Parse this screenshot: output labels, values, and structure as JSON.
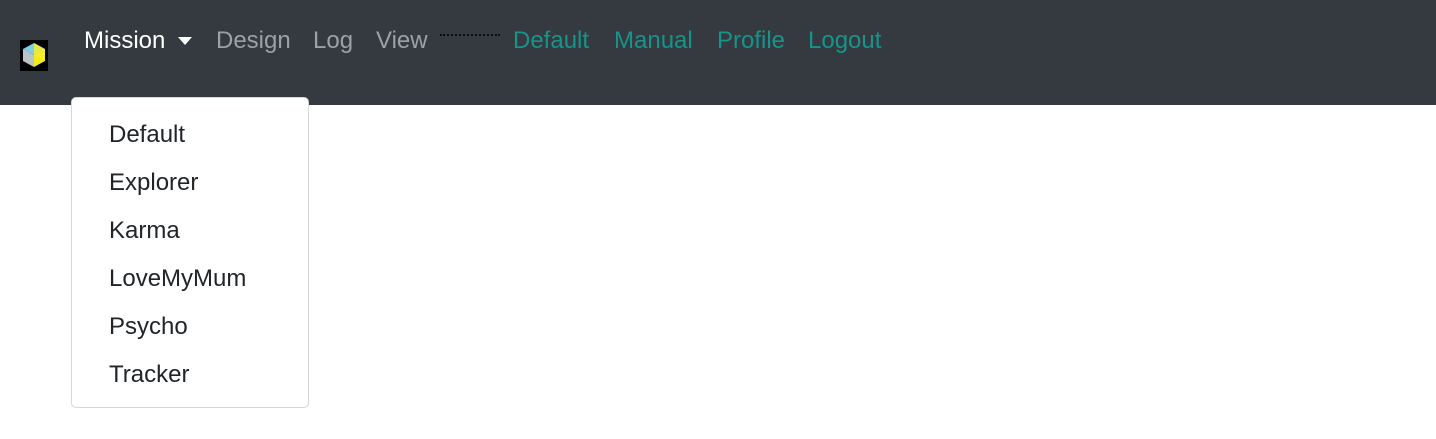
{
  "navbar": {
    "brand_icon": "cube-logo-icon",
    "mission_label": "Mission",
    "design_label": "Design",
    "log_label": "Log",
    "view_label": "View",
    "default_label": "Default",
    "manual_label": "Manual",
    "profile_label": "Profile",
    "logout_label": "Logout",
    "colors": {
      "background": "#343a40",
      "active": "#ffffff",
      "muted": "#9da1a6",
      "accent": "#17948a"
    }
  },
  "mission_menu": {
    "items": [
      "Default",
      "Explorer",
      "Karma",
      "LoveMyMum",
      "Psycho",
      "Tracker"
    ]
  }
}
